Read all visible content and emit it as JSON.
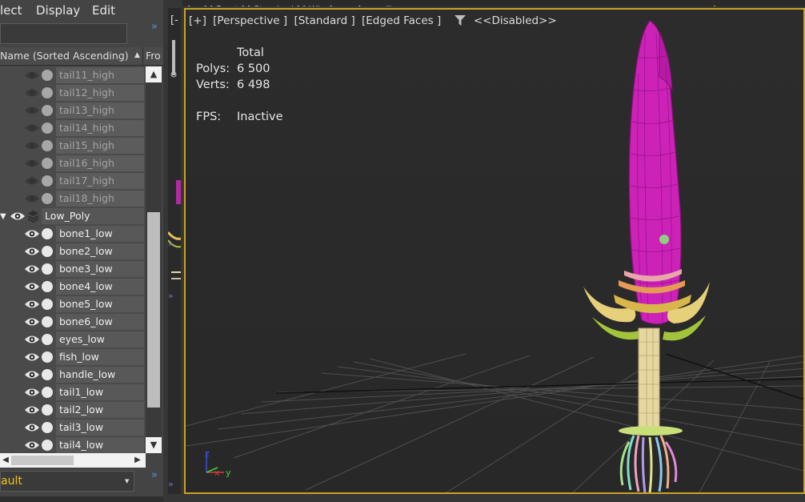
{
  "menubar": {
    "items": [
      "lect",
      "Display",
      "Edit"
    ]
  },
  "explorer": {
    "column_name": "Name (Sorted Ascending)",
    "column_frozen": "Fro",
    "hidden_items": [
      "tail11_high",
      "tail12_high",
      "tail13_high",
      "tail14_high",
      "tail15_high",
      "tail16_high",
      "tail17_high",
      "tail18_high"
    ],
    "layer_name": "Low_Poly",
    "visible_items": [
      "bone1_low",
      "bone2_low",
      "bone3_low",
      "bone4_low",
      "bone5_low",
      "bone6_low",
      "eyes_low",
      "fish_low",
      "handle_low",
      "tail1_low",
      "tail2_low",
      "tail3_low",
      "tail4_low"
    ],
    "layer_dropdown_value": "ault"
  },
  "left_viewport": {
    "label": "[-"
  },
  "viewport": {
    "labels": [
      "[+]",
      "[Perspective ]",
      "[Standard ]",
      "[Edged Faces ]"
    ],
    "filter_label": "<<Disabled>>",
    "stats": {
      "header": "Total",
      "polys_label": "Polys:",
      "polys_value": "6 500",
      "verts_label": "Verts:",
      "verts_value": "6 498",
      "fps_label": "FPS:",
      "fps_value": "Inactive"
    },
    "axis_labels": {
      "z": "z",
      "x": "x",
      "y": "y"
    }
  },
  "colors": {
    "active_border": "#c9a227",
    "accent_blue": "#5b8fd6",
    "blade_magenta": "#cc22b8",
    "handle_cream": "#e6d7a0",
    "layer_yellow": "#f2c21a"
  }
}
